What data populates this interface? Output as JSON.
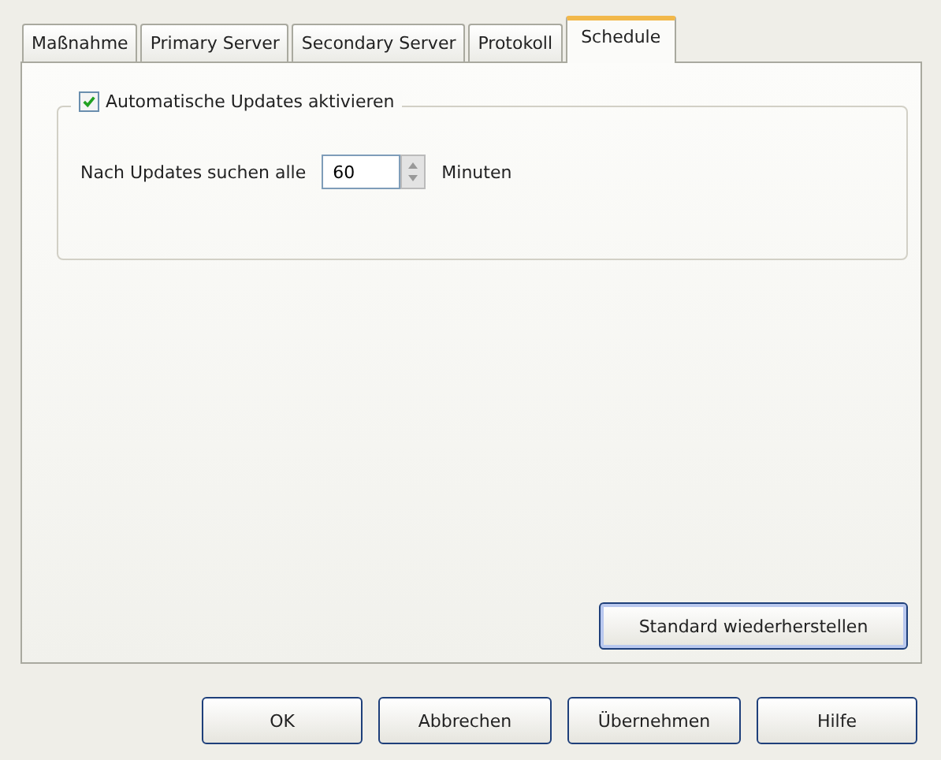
{
  "tabs": [
    {
      "label": "Maßnahme",
      "selected": false
    },
    {
      "label": "Primary Server",
      "selected": false
    },
    {
      "label": "Secondary Server",
      "selected": false
    },
    {
      "label": "Protokoll",
      "selected": false
    },
    {
      "label": "Schedule",
      "selected": true
    }
  ],
  "group": {
    "checkbox": {
      "label": "Automatische Updates aktivieren",
      "checked": true
    },
    "interval": {
      "label": "Nach Updates suchen alle",
      "value": "60",
      "unit": "Minuten"
    }
  },
  "restore_button": "Standard wiederherstellen",
  "buttons": [
    "OK",
    "Abbrechen",
    "Übernehmen",
    "Hilfe"
  ]
}
